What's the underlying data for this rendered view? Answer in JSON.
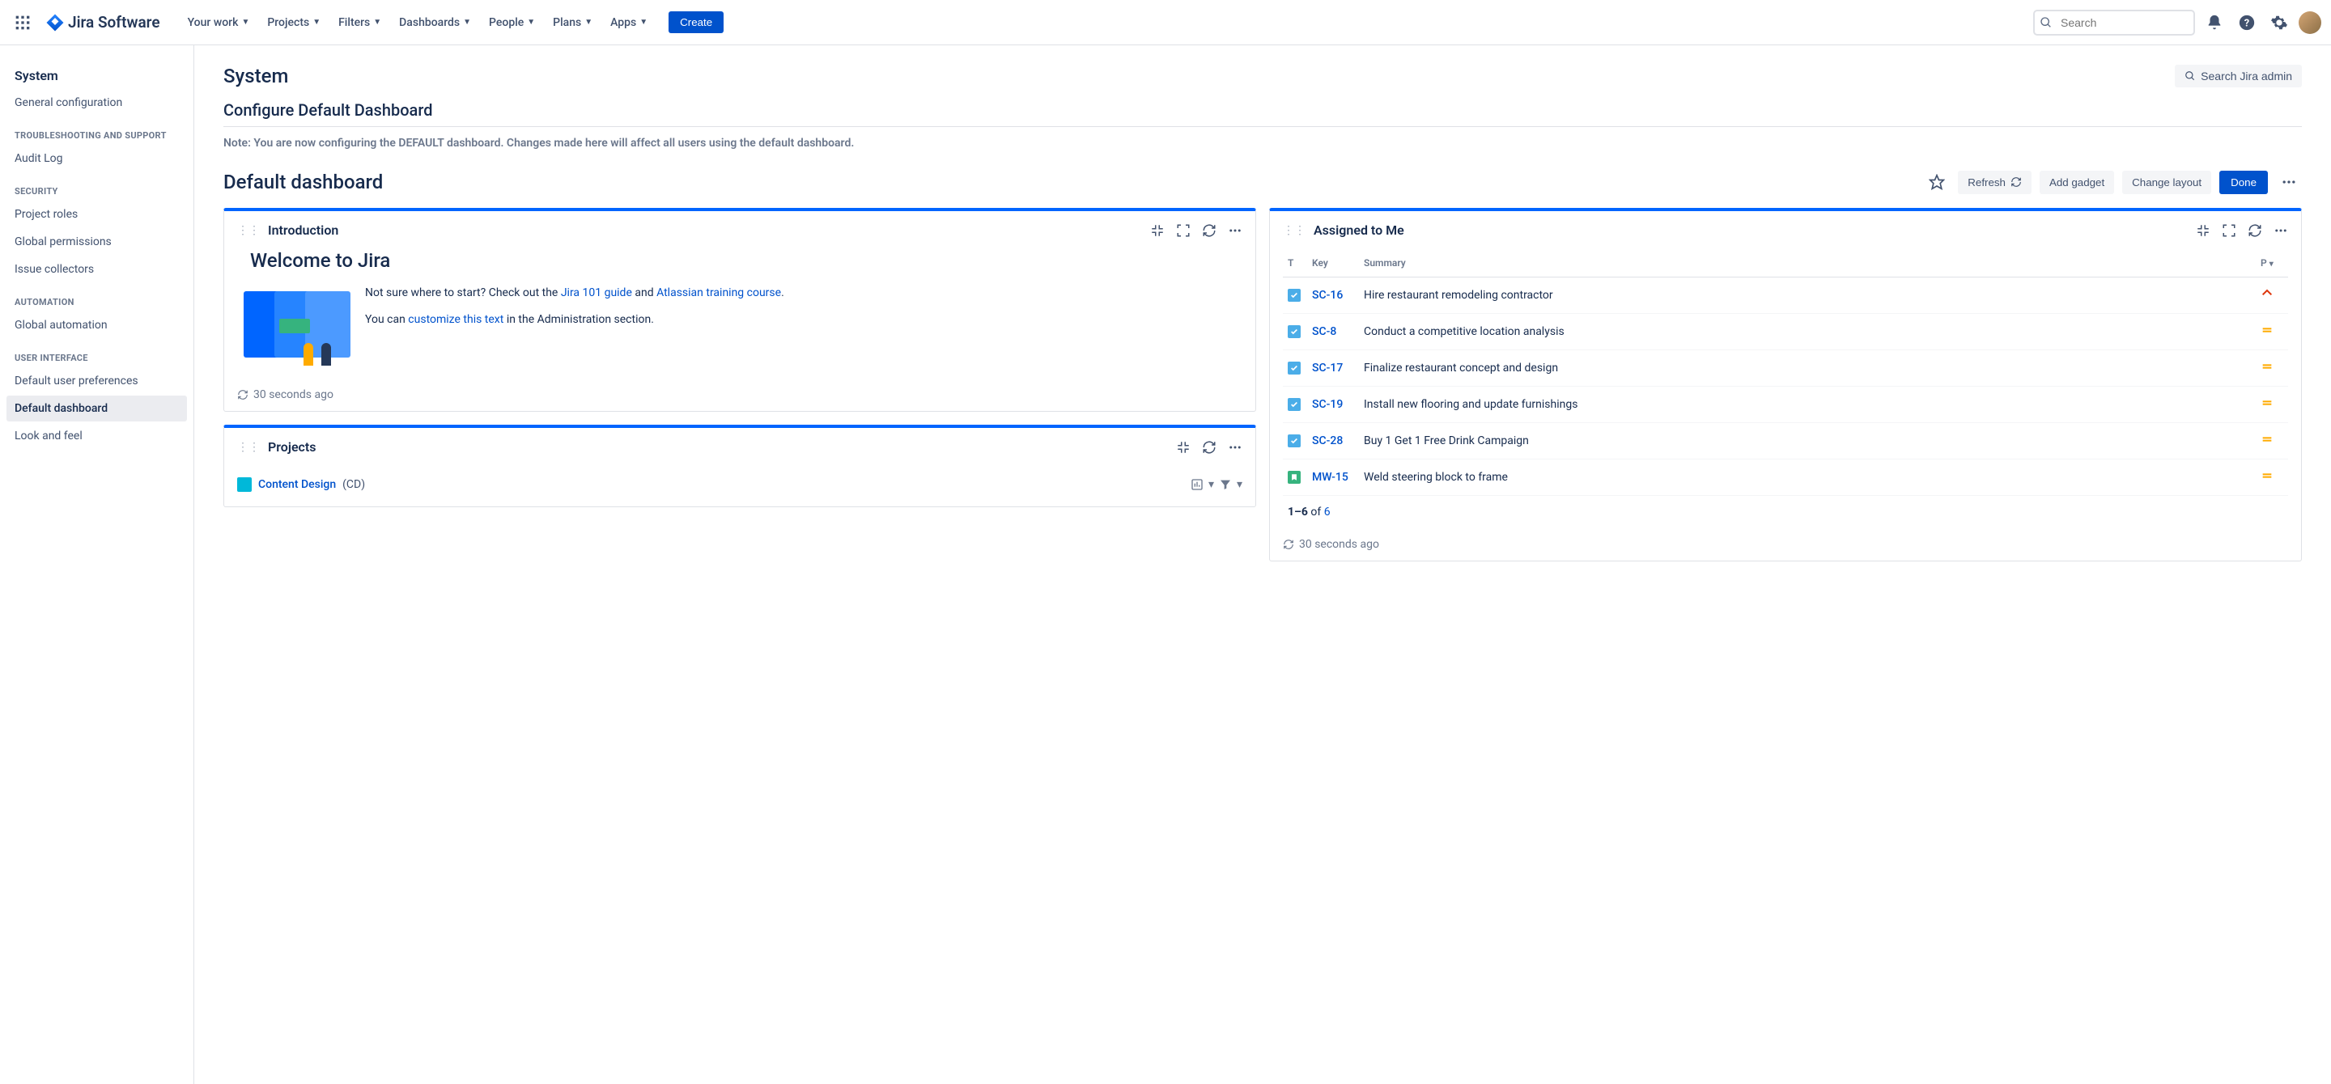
{
  "nav": {
    "logo_text": "Jira Software",
    "items": [
      "Your work",
      "Projects",
      "Filters",
      "Dashboards",
      "People",
      "Plans",
      "Apps"
    ],
    "create": "Create",
    "search_placeholder": "Search"
  },
  "sidebar": {
    "title": "System",
    "groups": [
      {
        "heading": null,
        "items": [
          "General configuration"
        ]
      },
      {
        "heading": "TROUBLESHOOTING AND SUPPORT",
        "items": [
          "Audit Log"
        ]
      },
      {
        "heading": "SECURITY",
        "items": [
          "Project roles",
          "Global permissions",
          "Issue collectors"
        ]
      },
      {
        "heading": "AUTOMATION",
        "items": [
          "Global automation"
        ]
      },
      {
        "heading": "USER INTERFACE",
        "items": [
          "Default user preferences",
          "Default dashboard",
          "Look and feel"
        ]
      }
    ],
    "selected": "Default dashboard"
  },
  "page": {
    "title": "System",
    "search_admin": "Search Jira admin",
    "section_title": "Configure Default Dashboard",
    "note": "Note: You are now configuring the DEFAULT dashboard. Changes made here will affect all users using the default dashboard."
  },
  "dashboard": {
    "title": "Default dashboard",
    "actions": {
      "refresh": "Refresh",
      "add_gadget": "Add gadget",
      "change_layout": "Change layout",
      "done": "Done"
    }
  },
  "intro_gadget": {
    "title": "Introduction",
    "welcome": "Welcome to Jira",
    "line1_a": "Not sure where to start? Check out the ",
    "link1": "Jira 101 guide",
    "line1_b": " and ",
    "link2": "Atlassian training course",
    "line1_c": ".",
    "line2_a": "You can ",
    "link3": "customize this text",
    "line2_b": " in the Administration section.",
    "timestamp": "30 seconds ago"
  },
  "projects_gadget": {
    "title": "Projects",
    "project_name": "Content Design",
    "project_key": "(CD)"
  },
  "assigned_gadget": {
    "title": "Assigned to Me",
    "columns": {
      "t": "T",
      "key": "Key",
      "summary": "Summary",
      "p": "P"
    },
    "rows": [
      {
        "type": "task",
        "key": "SC-16",
        "summary": "Hire restaurant remodeling contractor",
        "priority": "high"
      },
      {
        "type": "task",
        "key": "SC-8",
        "summary": "Conduct a competitive location analysis",
        "priority": "med"
      },
      {
        "type": "task",
        "key": "SC-17",
        "summary": "Finalize restaurant concept and design",
        "priority": "med"
      },
      {
        "type": "task",
        "key": "SC-19",
        "summary": "Install new flooring and update furnishings",
        "priority": "med"
      },
      {
        "type": "task",
        "key": "SC-28",
        "summary": "Buy 1 Get 1 Free Drink Campaign",
        "priority": "med"
      },
      {
        "type": "story",
        "key": "MW-15",
        "summary": "Weld steering block to frame",
        "priority": "med"
      }
    ],
    "pagination_a": "1–6",
    "pagination_b": " of ",
    "pagination_link": "6",
    "timestamp": "30 seconds ago"
  }
}
